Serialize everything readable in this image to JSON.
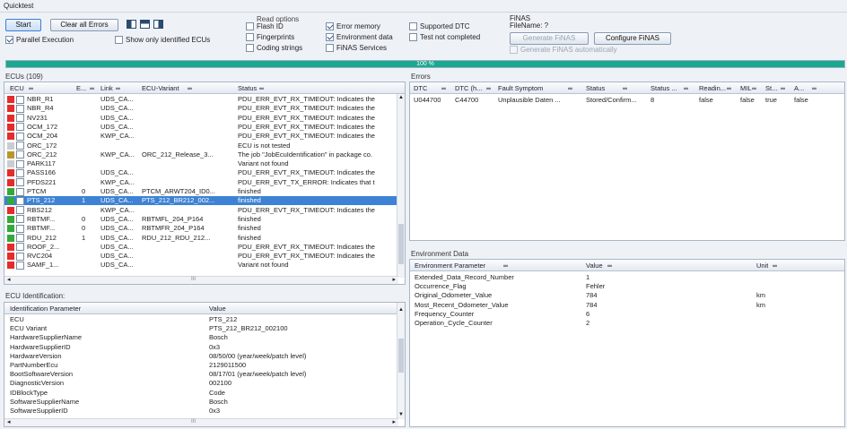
{
  "window_title": "Quicktest",
  "toolbar": {
    "start": "Start",
    "clear_all_errors": "Clear all Errors",
    "parallel_execution": "Parallel Execution",
    "show_only_identified": "Show only identified ECUs"
  },
  "read_options": {
    "title": "Read options",
    "flash_id": "Flash ID",
    "fingerprints": "Fingerprints",
    "coding_strings": "Coding strings",
    "error_memory": "Error memory",
    "environment_data": "Environment data",
    "finas_services": "FiNAS Services",
    "supported_dtc": "Supported DTC",
    "test_not_completed": "Test not completed"
  },
  "finas": {
    "title": "FiNAS",
    "filename": "FileName: ?",
    "generate": "Generate FiNAS",
    "configure": "Configure FiNAS",
    "auto": "Generate FiNAS automatically"
  },
  "progress": {
    "label": "100 %",
    "value": 100
  },
  "ecus": {
    "title": "ECUs (109)",
    "headers": [
      "ECU",
      "E...",
      "Link",
      "ECU-Variant",
      "Status"
    ],
    "rows": [
      {
        "color": "#e62b2b",
        "ecu": "NBR_R1",
        "e": "",
        "link": "UDS_CA...",
        "variant": "",
        "status": "PDU_ERR_EVT_RX_TIMEOUT: Indicates the"
      },
      {
        "color": "#e62b2b",
        "ecu": "NBR_R4",
        "e": "",
        "link": "UDS_CA...",
        "variant": "",
        "status": "PDU_ERR_EVT_RX_TIMEOUT: Indicates the"
      },
      {
        "color": "#e62b2b",
        "ecu": "NV231",
        "e": "",
        "link": "UDS_CA...",
        "variant": "",
        "status": "PDU_ERR_EVT_RX_TIMEOUT: Indicates the"
      },
      {
        "color": "#e62b2b",
        "ecu": "OCM_172",
        "e": "",
        "link": "UDS_CA...",
        "variant": "",
        "status": "PDU_ERR_EVT_RX_TIMEOUT: Indicates the"
      },
      {
        "color": "#e62b2b",
        "ecu": "OCM_204",
        "e": "",
        "link": "KWP_CA...",
        "variant": "",
        "status": "PDU_ERR_EVT_RX_TIMEOUT: Indicates the"
      },
      {
        "color": "#c9cdd2",
        "ecu": "ORC_172",
        "e": "",
        "link": "",
        "variant": "",
        "status": "ECU is not tested"
      },
      {
        "color": "#b8962e",
        "ecu": "ORC_212",
        "e": "",
        "link": "KWP_CA...",
        "variant": "ORC_212_Release_3...",
        "status": "The job \"JobEcuIdentification\" in package co."
      },
      {
        "color": "#c9cdd2",
        "ecu": "PARK117",
        "e": "",
        "link": "",
        "variant": "",
        "status": "Variant not found"
      },
      {
        "color": "#e62b2b",
        "ecu": "PASS166",
        "e": "",
        "link": "UDS_CA...",
        "variant": "",
        "status": "PDU_ERR_EVT_RX_TIMEOUT: Indicates the"
      },
      {
        "color": "#e62b2b",
        "ecu": "PFDS221",
        "e": "",
        "link": "KWP_CA...",
        "variant": "",
        "status": "PDU_ERR_EVT_TX_ERROR: Indicates that t"
      },
      {
        "color": "#34a93a",
        "ecu": "PTCM",
        "e": "0",
        "link": "UDS_CA...",
        "variant": "PTCM_ARWT204_ID0...",
        "status": "finished"
      },
      {
        "color": "#34a93a",
        "ecu": "PTS_212",
        "e": "1",
        "link": "UDS_CA...",
        "variant": "PTS_212_BR212_002...",
        "status": "finished",
        "selected": true
      },
      {
        "color": "#e62b2b",
        "ecu": "RBS212",
        "e": "",
        "link": "KWP_CA...",
        "variant": "",
        "status": "PDU_ERR_EVT_RX_TIMEOUT: Indicates the"
      },
      {
        "color": "#34a93a",
        "ecu": "RBTMF...",
        "e": "0",
        "link": "UDS_CA...",
        "variant": "RBTMFL_204_P164",
        "status": "finished"
      },
      {
        "color": "#34a93a",
        "ecu": "RBTMF...",
        "e": "0",
        "link": "UDS_CA...",
        "variant": "RBTMFR_204_P164",
        "status": "finished"
      },
      {
        "color": "#34a93a",
        "ecu": "RDU_212",
        "e": "1",
        "link": "UDS_CA...",
        "variant": "RDU_212_RDU_212...",
        "status": "finished"
      },
      {
        "color": "#e62b2b",
        "ecu": "ROOF_2...",
        "e": "",
        "link": "UDS_CA...",
        "variant": "",
        "status": "PDU_ERR_EVT_RX_TIMEOUT: Indicates the"
      },
      {
        "color": "#e62b2b",
        "ecu": "RVC204",
        "e": "",
        "link": "UDS_CA...",
        "variant": "",
        "status": "PDU_ERR_EVT_RX_TIMEOUT: Indicates the"
      },
      {
        "color": "#e62b2b",
        "ecu": "SAMF_1...",
        "e": "",
        "link": "UDS_CA...",
        "variant": "",
        "status": "Variant not found"
      }
    ],
    "scroll_marker": "III"
  },
  "ecu_identification": {
    "title": "ECU Identification:",
    "headers": [
      "Identification Parameter",
      "Value"
    ],
    "rows": [
      {
        "param": "ECU",
        "value": "PTS_212"
      },
      {
        "param": "ECU Variant",
        "value": "PTS_212_BR212_002100"
      },
      {
        "param": "HardwareSupplierName",
        "value": "Bosch"
      },
      {
        "param": "HardwareSupplierID",
        "value": "0x3"
      },
      {
        "param": "HardwareVersion",
        "value": "08/50/00 (year/week/patch level)"
      },
      {
        "param": "PartNumberEcu",
        "value": "2129011500"
      },
      {
        "param": "BootSoftwareVersion",
        "value": "08/17/01 (year/week/patch level)"
      },
      {
        "param": "DiagnosticVersion",
        "value": "002100"
      },
      {
        "param": "IDBlockType",
        "value": "Code"
      },
      {
        "param": "SoftwareSupplierName",
        "value": "Bosch"
      },
      {
        "param": "SoftwareSupplierID",
        "value": "0x3"
      }
    ],
    "scroll_marker": "III"
  },
  "errors": {
    "title": "Errors",
    "headers": [
      "DTC",
      "DTC (h...",
      "Fault Symptom",
      "Status",
      "Status ...",
      "Readin...",
      "MIL",
      "St...",
      "A..."
    ],
    "rows": [
      {
        "dtc": "U044700",
        "dtch": "C44700",
        "fault": "Unplausible Daten ...",
        "status": "Stored/Confirm...",
        "status2": "8",
        "reading": "false",
        "mil": "false",
        "st": "true",
        "a": "false"
      }
    ]
  },
  "environment": {
    "title": "Environment Data",
    "headers": [
      "Environment Parameter",
      "Value",
      "Unit"
    ],
    "rows": [
      {
        "param": "Extended_Data_Record_Number",
        "value": "1",
        "unit": ""
      },
      {
        "param": "Occurrence_Flag",
        "value": "Fehler",
        "unit": ""
      },
      {
        "param": "Original_Odometer_Value",
        "value": "784",
        "unit": "km"
      },
      {
        "param": "Most_Recent_Odometer_Value",
        "value": "784",
        "unit": "km"
      },
      {
        "param": "Frequency_Counter",
        "value": "6",
        "unit": ""
      },
      {
        "param": "Operation_Cycle_Counter",
        "value": "2",
        "unit": ""
      }
    ]
  },
  "colors": {
    "progress": "#1aa88e",
    "selection": "#3d82d4",
    "error": "#e62b2b",
    "ok": "#34a93a",
    "untested": "#c9cdd2",
    "warning": "#b8962e"
  }
}
